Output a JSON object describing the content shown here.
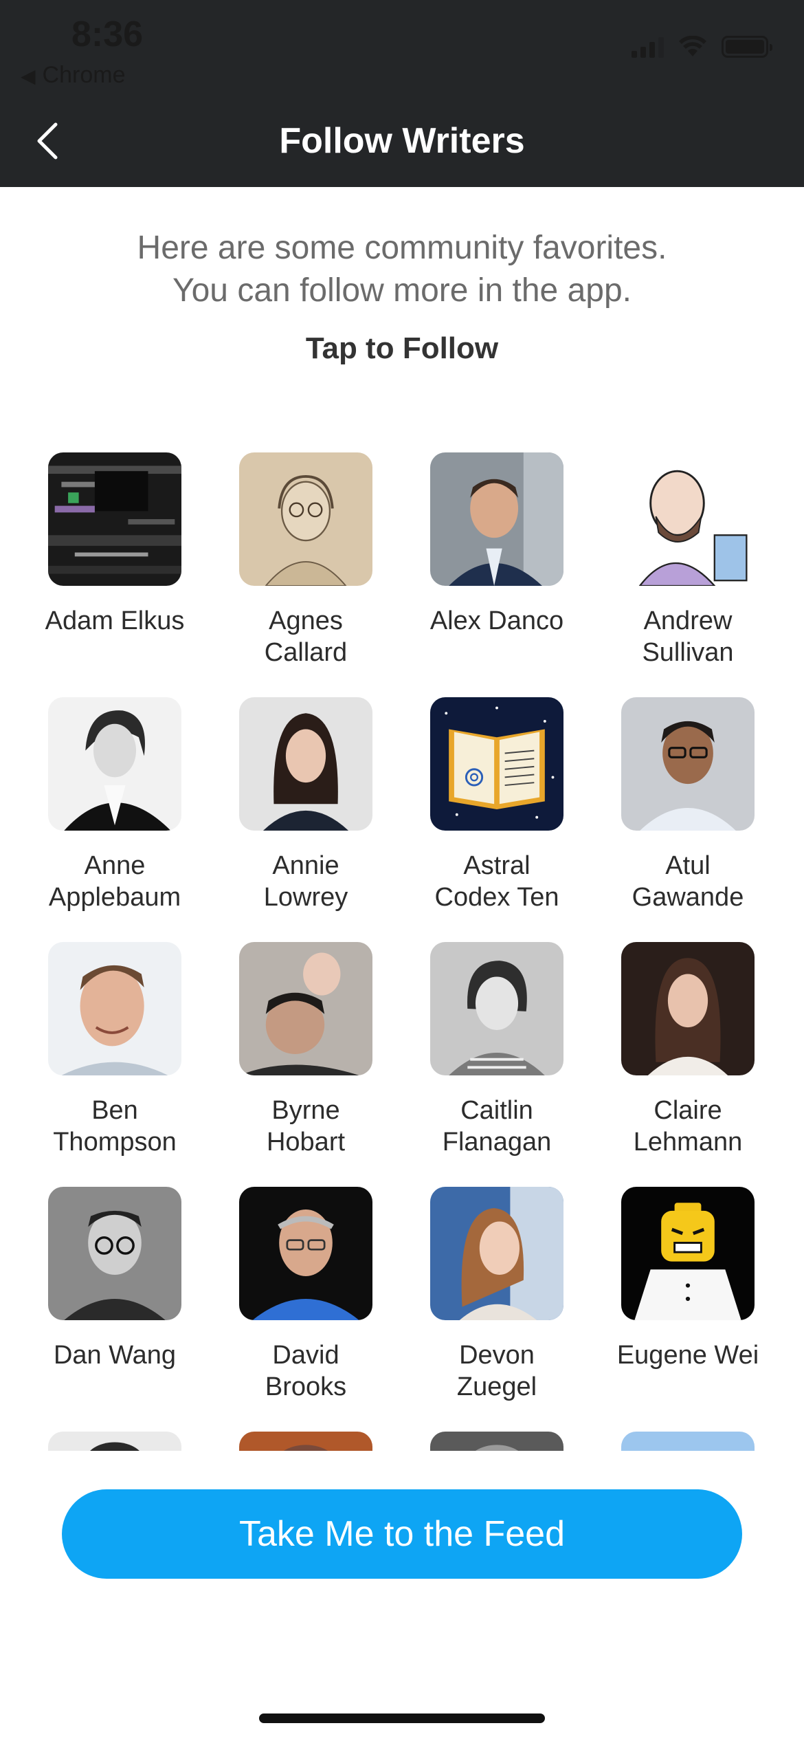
{
  "status_bar": {
    "time": "8:36",
    "back_app": "Chrome"
  },
  "header": {
    "title": "Follow Writers"
  },
  "intro": {
    "line1": "Here are some community favorites.",
    "line2": "You can follow more in the app.",
    "tap_to_follow": "Tap to Follow"
  },
  "writers": [
    {
      "name": "Adam Elkus"
    },
    {
      "name": "Agnes\nCallard"
    },
    {
      "name": "Alex Danco"
    },
    {
      "name": "Andrew\nSullivan"
    },
    {
      "name": "Anne\nApplebaum"
    },
    {
      "name": "Annie\nLowrey"
    },
    {
      "name": "Astral\nCodex Ten"
    },
    {
      "name": "Atul\nGawande"
    },
    {
      "name": "Ben\nThompson"
    },
    {
      "name": "Byrne\nHobart"
    },
    {
      "name": "Caitlin\nFlanagan"
    },
    {
      "name": "Claire\nLehmann"
    },
    {
      "name": "Dan Wang"
    },
    {
      "name": "David\nBrooks"
    },
    {
      "name": "Devon\nZuegel"
    },
    {
      "name": "Eugene Wei"
    }
  ],
  "cta": {
    "label": "Take Me to the Feed"
  },
  "colors": {
    "header_bg": "#242628",
    "cta_bg": "#0ea5f4"
  }
}
